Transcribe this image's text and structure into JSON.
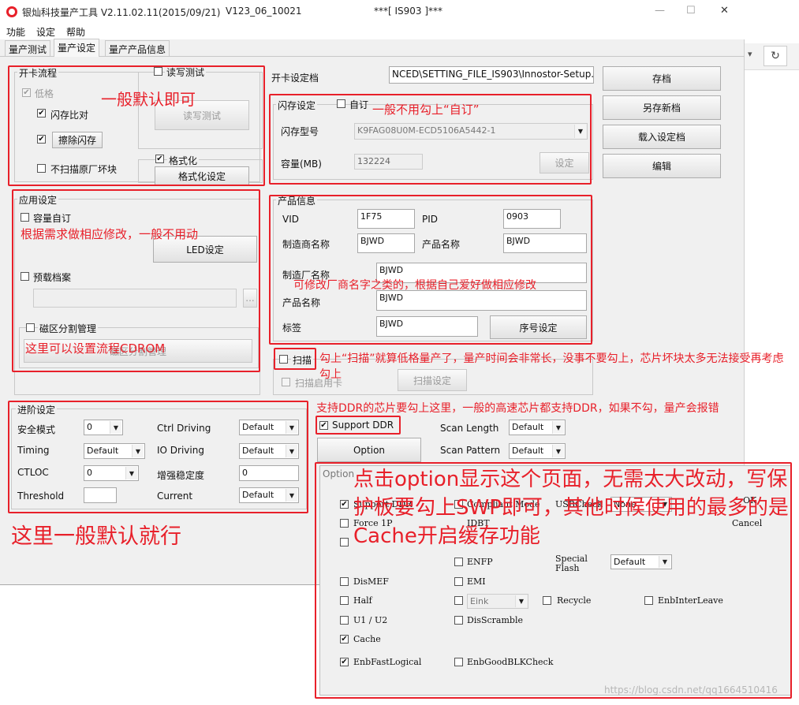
{
  "title": {
    "app": "银灿科技量产工具 V2.11.02.11(2015/09/21)",
    "build": "V123_06_10021",
    "chip": "***[ IS903 ]***"
  },
  "menu": [
    "功能",
    "设定",
    "帮助"
  ],
  "tabs": [
    "量产测试",
    "量产设定",
    "量产产品信息"
  ],
  "card_flow": {
    "label": "开卡流程",
    "low_format": "低格",
    "flash_compare": "闪存比对",
    "erase_flash": "擦除闪存",
    "no_scan_bad": "不扫描原厂坏块"
  },
  "rw_test": {
    "label": "读写测试",
    "button": "读写测试"
  },
  "format": {
    "label": "格式化",
    "button": "格式化设定"
  },
  "settings_file": {
    "label": "开卡设定档",
    "value": "NCED\\SETTING_FILE_IS903\\Innostor-Setup.ini"
  },
  "right_buttons": [
    "存档",
    "另存新档",
    "载入设定档",
    "编辑"
  ],
  "flash_settings": {
    "label": "闪存设定",
    "custom": "自订",
    "model_label": "闪存型号",
    "model_value": "K9FAG08U0M-ECD5106A5442-1",
    "capacity_label": "容量(MB)",
    "capacity_value": "132224",
    "set_button": "设定"
  },
  "app_settings": {
    "label": "应用设定",
    "capacity_custom": "容量自订",
    "led_button": "LED设定",
    "preload": "预载档案",
    "browse": "...",
    "partition": "磁区分割管理",
    "partition_button": "磁区分割管理"
  },
  "product_info": {
    "label": "产品信息",
    "vid_label": "VID",
    "vid": "1F75",
    "pid_label": "PID",
    "pid": "0903",
    "vendor_label": "制造商名称",
    "vendor": "BJWD",
    "product_label": "产品名称",
    "product": "BJWD",
    "manufacturer_label": "制造厂名称",
    "manufacturer": "BJWD",
    "product2_label": "产品名称",
    "product2": "BJWD",
    "tag_label": "标签",
    "tag": "BJWD",
    "serial_button": "序号设定"
  },
  "scan": {
    "label": "扫描",
    "scan_after": "扫描启用卡",
    "scan_button": "扫描设定"
  },
  "advanced": {
    "label": "进阶设定",
    "safe_mode": "安全模式",
    "safe_mode_value": "0",
    "timing": "Timing",
    "timing_value": "Default",
    "ctloc": "CTLOC",
    "ctloc_value": "0",
    "threshold": "Threshold",
    "threshold_value": "",
    "ctrl_driving": "Ctrl Driving",
    "ctrl_driving_value": "Default",
    "io_driving": "IO Driving",
    "io_driving_value": "Default",
    "stability": "增强稳定度",
    "stability_value": "0",
    "current": "Current",
    "current_value": "Default"
  },
  "ddr": {
    "support_ddr": "Support DDR",
    "option_button": "Option",
    "scan_length": "Scan Length",
    "scan_length_value": "Default",
    "scan_pattern": "Scan Pattern",
    "scan_pattern_value": "Default"
  },
  "option_panel": {
    "title": "Option",
    "support_ddr": "Support DDR",
    "compliant_mode": "Compliant Mode",
    "usb_check": "USBCheck",
    "usb_check_value": "None",
    "ok": "OK",
    "force1p": "Force 1P",
    "idbt": "IDBT",
    "cancel": "Cancel",
    "enfp": "ENFP",
    "special_flash": "Special Flash",
    "special_flash_value": "Default",
    "dismef": "DisMEF",
    "emi": "EMI",
    "half": "Half",
    "eink": "Eink",
    "recycle": "Recycle",
    "enb_interleave": "EnbInterLeave",
    "u1u2": "U1 / U2",
    "disscramble": "DisScramble",
    "cache": "Cache",
    "enb_fast_logical": "EnbFastLogical",
    "enb_good_blk": "EnbGoodBLKCheck"
  },
  "annotations": {
    "a1": "一般默认即可",
    "a2": "一般不用勾上“自订”",
    "a3": "根据需求做相应修改，一般不用动",
    "a4": "可修改厂商名字之类的，根据自己爱好做相应修改",
    "a5": "这里可以设置流程CDROM",
    "a6": "勾上“扫描”就算低格量产了，量产时间会非常长，没事不要勾上，芯片坏块太多无法接受再考虑勾上",
    "a7": "支持DDR的芯片要勾上这里，一般的高速芯片都支持DDR，如果不勾，量产会报错",
    "a8": "这里一般默认就行",
    "a9": "点击option显示这个页面，无需太大改动，写保护板要勾上SWP即可，其他时候使用的最多的是Cache开启缓存功能"
  },
  "watermark": "https://blog.csdn.net/qq1664510416",
  "colors": {
    "annotation": "#e8202a",
    "window": "#f0f0f0"
  }
}
